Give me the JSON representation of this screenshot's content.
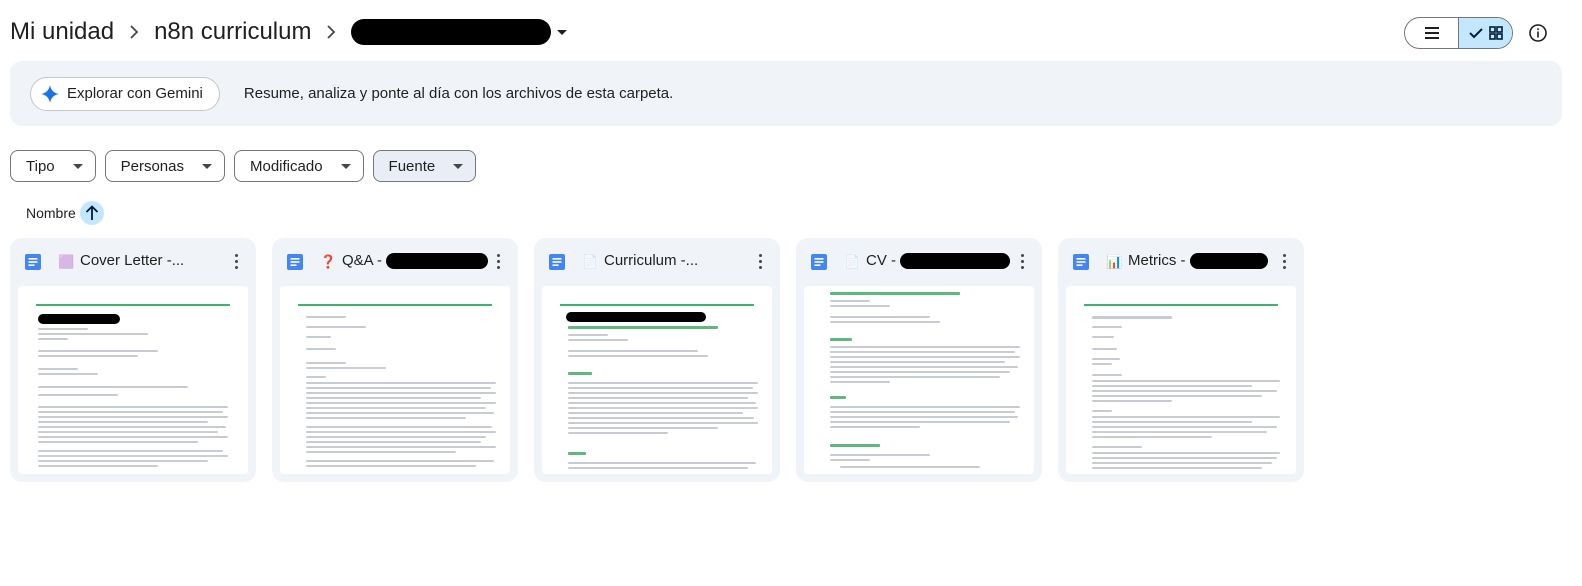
{
  "breadcrumb": {
    "items": [
      "Mi unidad",
      "n8n curriculum"
    ],
    "current_redacted": true
  },
  "view": {
    "mode": "grid"
  },
  "banner": {
    "button_label": "Explorar con Gemini",
    "text": "Resume, analiza y ponte al día con los archivos de esta carpeta."
  },
  "filters": [
    "Tipo",
    "Personas",
    "Modificado",
    "Fuente"
  ],
  "sort": {
    "label": "Nombre",
    "direction": "ascending"
  },
  "files": [
    {
      "title": "Cover Letter -...",
      "emoji": "🟪",
      "icon": "google-docs-icon"
    },
    {
      "title": "Q&A -",
      "emoji": "❓",
      "icon": "google-docs-icon"
    },
    {
      "title": "Curriculum -...",
      "emoji": "📄",
      "icon": "google-docs-icon"
    },
    {
      "title": "CV -",
      "emoji": "📄",
      "icon": "google-docs-icon"
    },
    {
      "title": "Metrics -",
      "emoji": "📊",
      "icon": "google-docs-icon"
    }
  ],
  "colors": {
    "accent": "#c2e7ff",
    "banner_bg": "#f0f4f9",
    "docs_blue": "#4285f4",
    "gemini_blue": "#1a73e8"
  }
}
